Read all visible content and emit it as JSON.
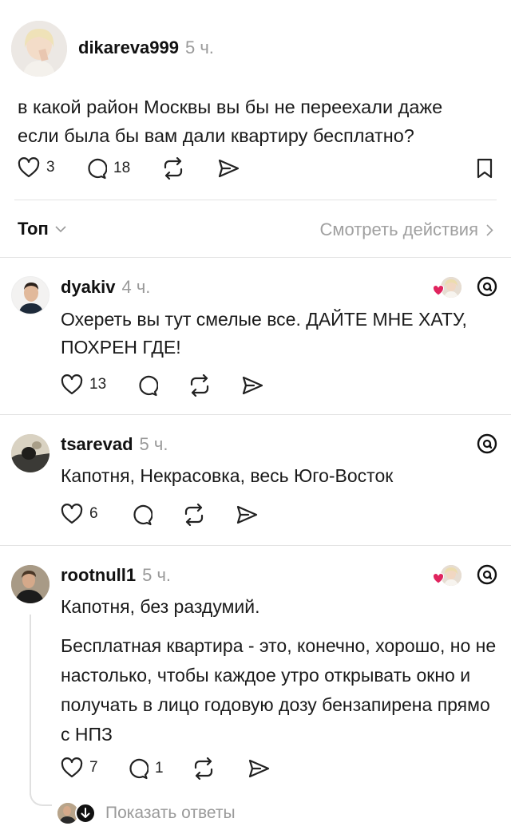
{
  "post": {
    "username": "dikareva999",
    "time": "5 ч.",
    "text": "в какой район Москвы вы бы не переехали даже если была бы вам дали квартиру бесплатно?",
    "likes": "3",
    "replies": "18"
  },
  "sort": {
    "label": "Топ",
    "activity_link": "Смотреть действия"
  },
  "comments": [
    {
      "username": "dyakiv",
      "time": "4 ч.",
      "text": "Охереть вы тут смелые все. ДАЙТЕ МНЕ ХАТУ, ПОХРЕН ГДЕ!",
      "likes": "13",
      "replies": ""
    },
    {
      "username": "tsarevad",
      "time": "5 ч.",
      "text": "Капотня, Некрасовка, весь Юго-Восток",
      "likes": "6",
      "replies": ""
    },
    {
      "username": "rootnull1",
      "time": "5 ч.",
      "text": "Капотня, без раздумий.",
      "text2": "Бесплатная квартира - это, конечно, хорошо, но не настолько, чтобы каждое утро открывать окно и получать в лицо годовую дозу бензапирена прямо с НПЗ",
      "likes": "7",
      "replies": "1"
    }
  ],
  "show_replies": "Показать ответы",
  "icons": [
    "heart-icon",
    "comment-icon",
    "repost-icon",
    "share-icon",
    "bookmark-icon",
    "chevron-down-icon",
    "chevron-right-icon",
    "threads-icon",
    "liked-by-author-icon",
    "arrow-down-icon"
  ]
}
